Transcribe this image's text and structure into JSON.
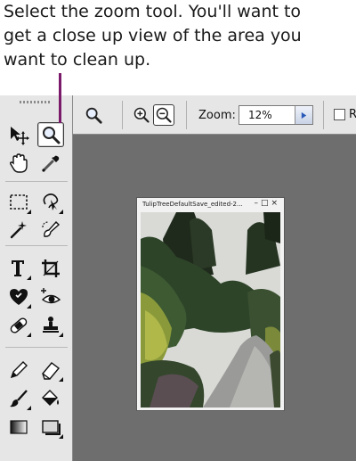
{
  "caption": {
    "line1": "Select the zoom tool. You'll want to",
    "line2": "get a close up view of the area you",
    "line3": "want to clean up."
  },
  "colors": {
    "callout": "#7b1a6a",
    "workspace": "#6e6e6e",
    "panel": "#e6e6e6",
    "zoom_arrow": "#2a5ab8"
  },
  "toolbox": {
    "tools": [
      {
        "name": "move-tool",
        "icon": "move-arrow-icon"
      },
      {
        "name": "zoom-tool",
        "icon": "magnifier-icon",
        "selected": true
      },
      {
        "name": "hand-tool",
        "icon": "hand-icon"
      },
      {
        "name": "eyedropper-tool",
        "icon": "eyedropper-icon"
      },
      {
        "name": "marquee-tool",
        "icon": "rect-marquee-icon"
      },
      {
        "name": "lasso-tool",
        "icon": "lasso-icon"
      },
      {
        "name": "magic-wand-tool",
        "icon": "magic-wand-icon"
      },
      {
        "name": "quick-selection-tool",
        "icon": "selection-brush-icon"
      },
      {
        "name": "type-tool",
        "icon": "type-t-icon"
      },
      {
        "name": "crop-tool",
        "icon": "crop-icon"
      },
      {
        "name": "cookie-cutter-tool",
        "icon": "heart-shape-icon"
      },
      {
        "name": "red-eye-tool",
        "icon": "red-eye-icon"
      },
      {
        "name": "spot-healing-tool",
        "icon": "bandage-icon"
      },
      {
        "name": "clone-stamp-tool",
        "icon": "stamp-icon"
      },
      {
        "name": "pencil-tool",
        "icon": "pencil-icon"
      },
      {
        "name": "eraser-tool",
        "icon": "eraser-icon"
      },
      {
        "name": "brush-tool",
        "icon": "brush-icon"
      },
      {
        "name": "paint-bucket-tool",
        "icon": "paint-bucket-icon"
      },
      {
        "name": "gradient-tool",
        "icon": "gradient-icon"
      },
      {
        "name": "shape-tool",
        "icon": "rectangle-shape-icon"
      }
    ]
  },
  "options_bar": {
    "zoom_label": "Zoom:",
    "zoom_value": "12%",
    "checkbox_label": "R"
  },
  "document": {
    "title": "TulipTreeDefaultSave_edited-2...",
    "controls": [
      "–",
      "□",
      "×"
    ]
  }
}
